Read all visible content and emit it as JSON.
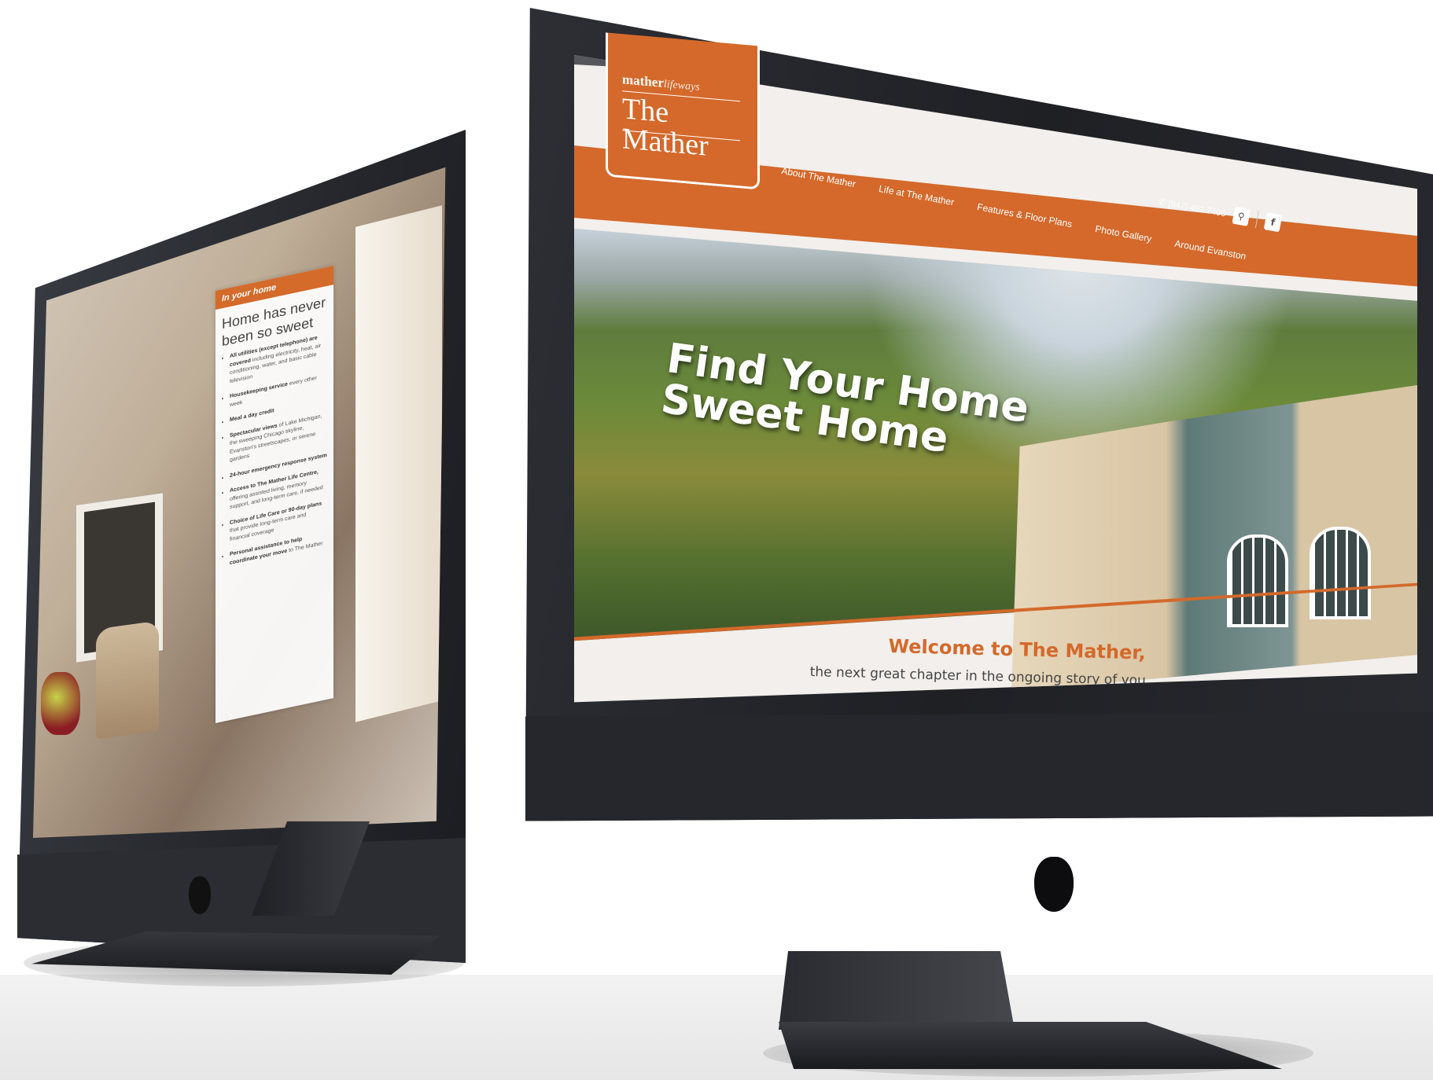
{
  "left_screen": {
    "card_heading": "In your home",
    "card_title": "Home has never been so sweet",
    "features": [
      {
        "strong": "All utilities (except telephone) are covered",
        "rest": " including electricity, heat, air conditioning, water, and basic cable television"
      },
      {
        "strong": "Housekeeping service",
        "rest": " every other week"
      },
      {
        "strong": "Meal a day credit",
        "rest": ""
      },
      {
        "strong": "Spectacular views",
        "rest": " of Lake Michigan, the sweeping Chicago skyline, Evanston's streetscapes, or serene gardens"
      },
      {
        "strong": "24-hour emergency response system",
        "rest": ""
      },
      {
        "strong": "Access to The Mather Life Centre,",
        "rest": " offering assisted living, memory support, and long-term care, if needed"
      },
      {
        "strong": "Choice of Life Care or 90-day plans",
        "rest": " that provide long-term care and financial coverage"
      },
      {
        "strong": "Personal assistance to help coordinate your move",
        "rest": " to The Mather"
      }
    ]
  },
  "right_screen": {
    "logo": {
      "brand_bold": "mather",
      "brand_light": "lifeways",
      "name": "The Mather"
    },
    "nav": [
      "About The Mather",
      "Life at The Mather",
      "Features & Floor Plans",
      "Photo Gallery",
      "Around Evanston"
    ],
    "phone": "(847) 492.7400",
    "hero_title_line1": "Find Your Home",
    "hero_title_line2": "Sweet Home",
    "welcome": "Welcome to The Mather,",
    "welcome_sub": "the next great chapter in the ongoing story of you."
  },
  "colors": {
    "brand_orange": "#d4692b",
    "nav_grey": "#55575c",
    "monitor_body": "#24262b"
  },
  "icons": [
    "phone-icon",
    "search-icon",
    "facebook-icon",
    "apple-logo-icon"
  ]
}
